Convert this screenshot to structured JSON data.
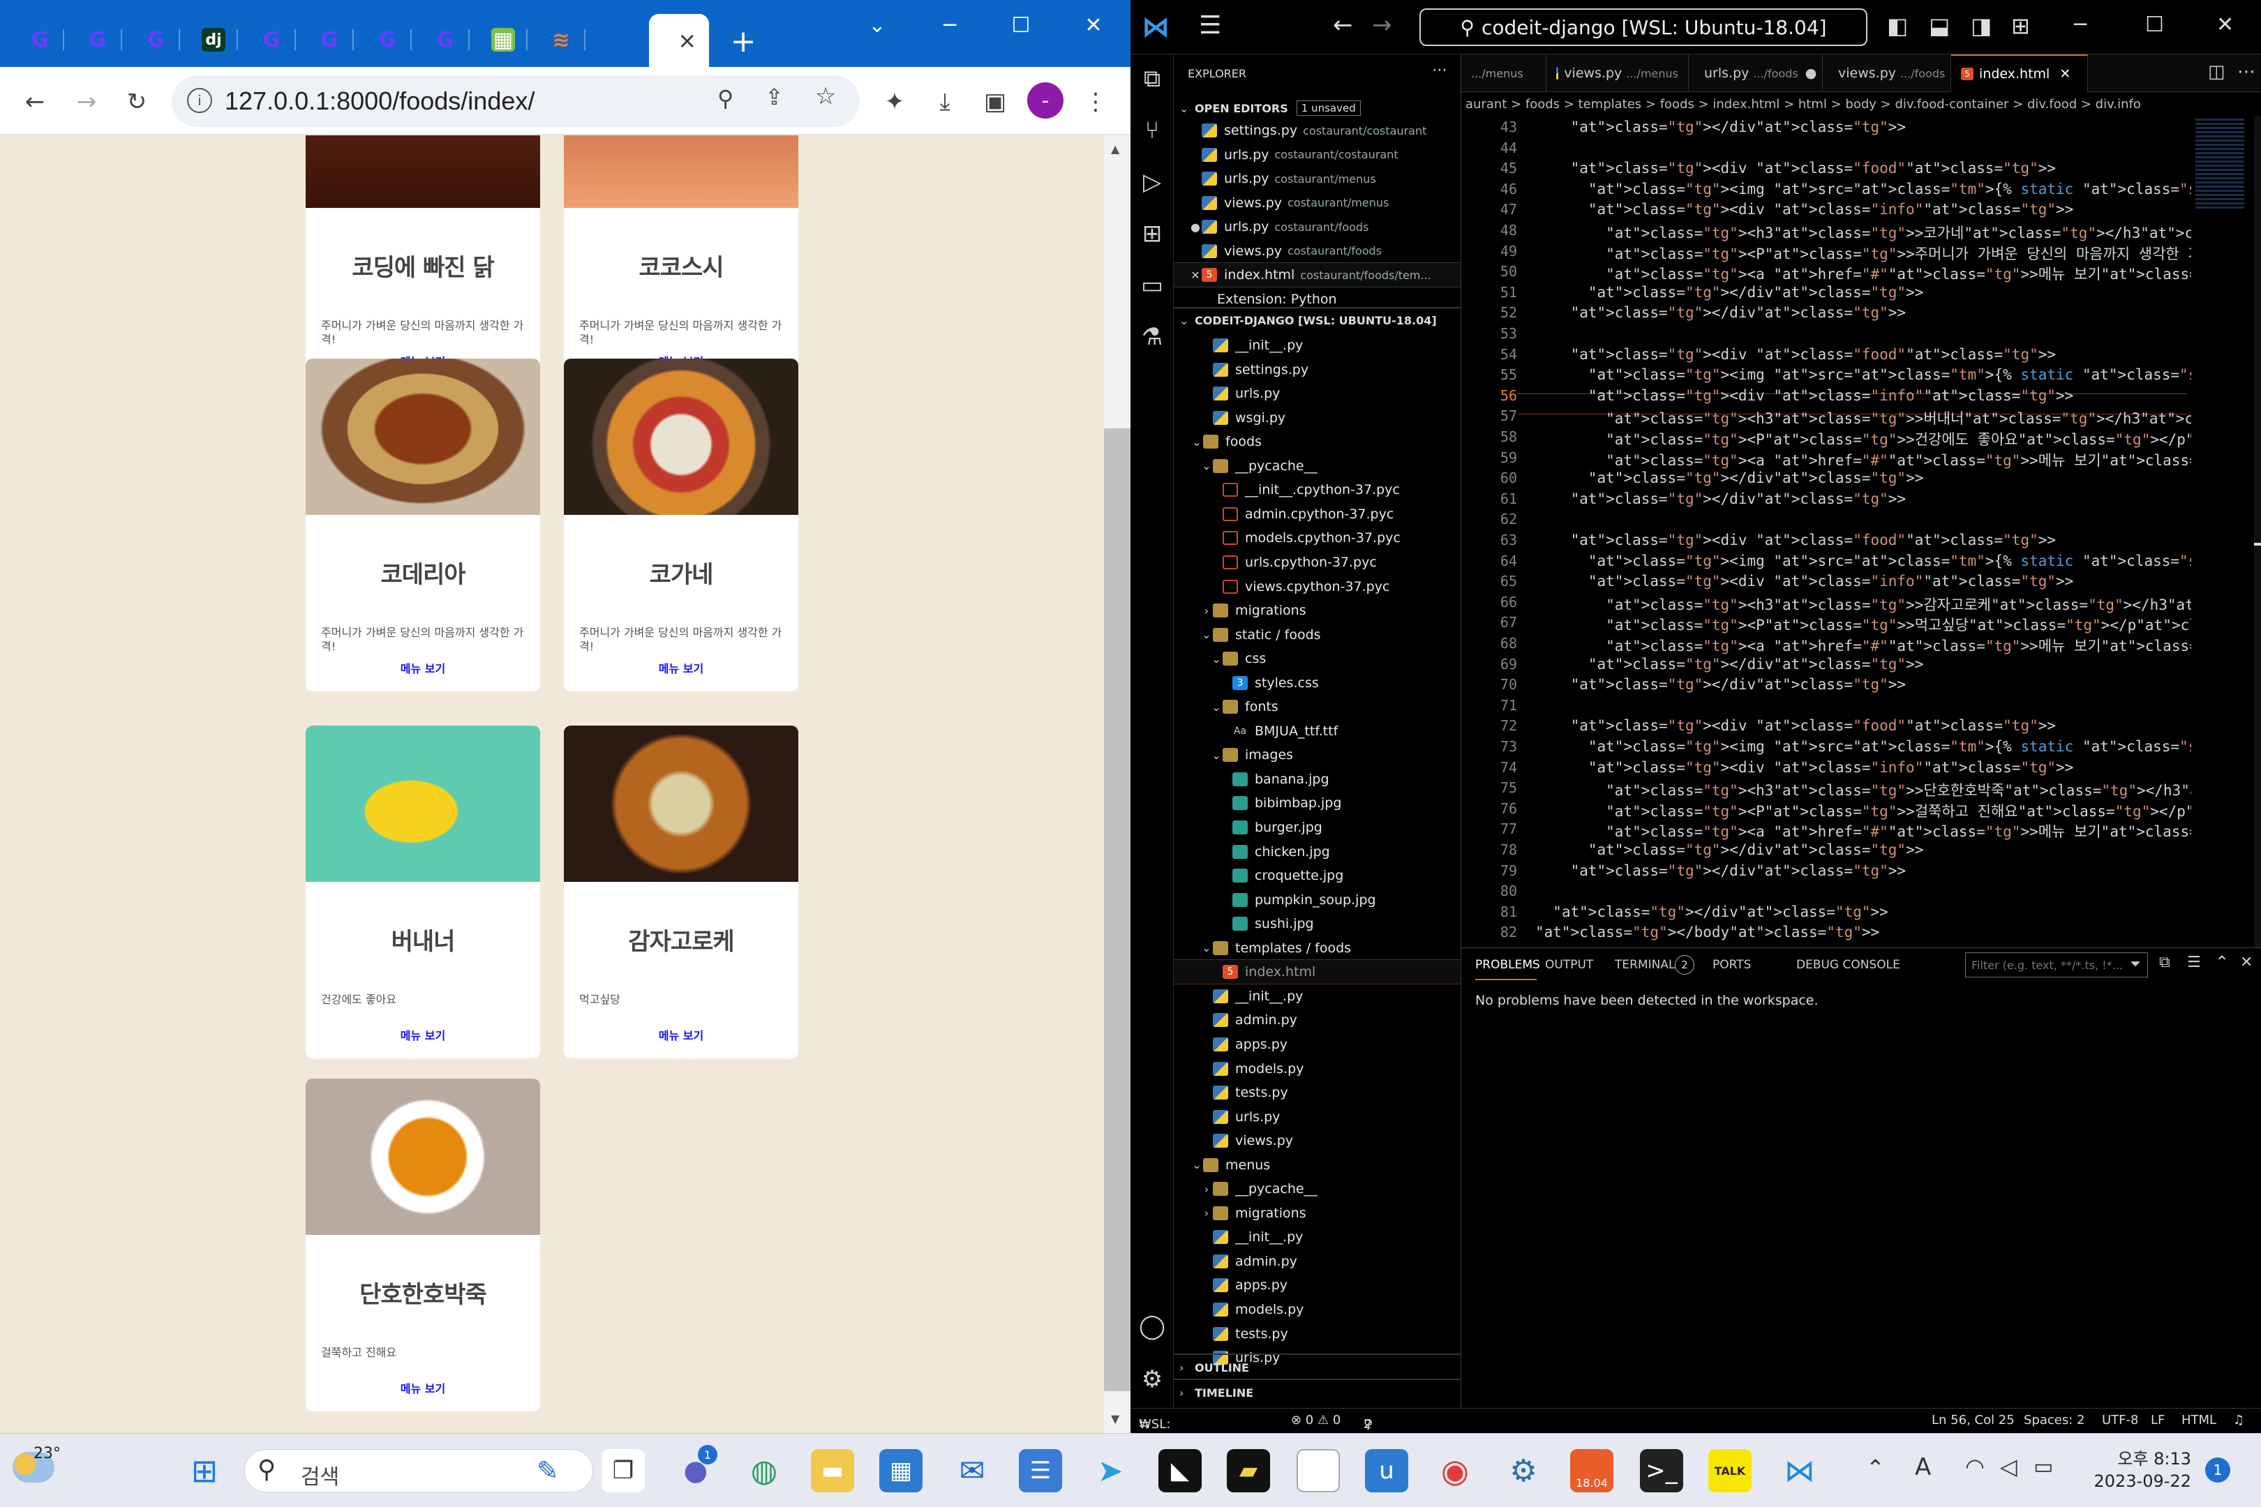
{
  "browser": {
    "url": "127.0.0.1:8000/foods/index/",
    "tab_count_icons": [
      "codeit",
      "codeit",
      "codeit",
      "django",
      "codeit",
      "codeit",
      "codeit",
      "codeit",
      "kakao",
      "stack"
    ],
    "new_tab_label": "+",
    "close_tab_label": "×"
  },
  "foods": [
    {
      "name": "코딩에 빠진 닭",
      "desc": "주머니가 가벼운 당신의 마음까지 생각한 가격!",
      "link": "메뉴 보기"
    },
    {
      "name": "코코스시",
      "desc": "주머니가 가벼운 당신의 마음까지 생각한 가격!",
      "link": "메뉴 보기"
    },
    {
      "name": "코데리아",
      "desc": "주머니가 가벼운 당신의 마음까지 생각한 가격!",
      "link": "메뉴 보기"
    },
    {
      "name": "코가네",
      "desc": "주머니가 가벼운 당신의 마음까지 생각한 가격!",
      "link": "메뉴 보기"
    },
    {
      "name": "버내너",
      "desc": "건강에도 좋아요",
      "link": "메뉴 보기"
    },
    {
      "name": "감자고로케",
      "desc": "먹고싶당",
      "link": "메뉴 보기"
    },
    {
      "name": "단호한호박죽",
      "desc": "걸쭉하고 진해요",
      "link": "메뉴 보기"
    }
  ],
  "vscode": {
    "command_center": "codeit-django [WSL: Ubuntu-18.04]",
    "explorer_title": "EXPLORER",
    "open_editors_label": "OPEN EDITORS",
    "unsaved_badge": "1 unsaved",
    "open_editors": [
      {
        "name": "settings.py",
        "path": "costaurant/costaurant"
      },
      {
        "name": "urls.py",
        "path": "costaurant/costaurant"
      },
      {
        "name": "urls.py",
        "path": "costaurant/menus"
      },
      {
        "name": "views.py",
        "path": "costaurant/menus"
      },
      {
        "name": "urls.py",
        "path": "costaurant/foods"
      },
      {
        "name": "views.py",
        "path": "costaurant/foods"
      },
      {
        "name": "index.html",
        "path": "costaurant/foods/tem..."
      },
      {
        "name": "Extension: Python",
        "path": ""
      }
    ],
    "workspace_label": "CODEIT-DJANGO [WSL: UBUNTU-18.04]",
    "tree": [
      {
        "name": "__init__.py",
        "kind": "py",
        "depth": 2
      },
      {
        "name": "settings.py",
        "kind": "py",
        "depth": 2
      },
      {
        "name": "urls.py",
        "kind": "py",
        "depth": 2
      },
      {
        "name": "wsgi.py",
        "kind": "py",
        "depth": 2
      },
      {
        "name": "foods",
        "kind": "folder-open",
        "depth": 1
      },
      {
        "name": "__pycache__",
        "kind": "folder-open",
        "depth": 2
      },
      {
        "name": "__init__.cpython-37.pyc",
        "kind": "pyc",
        "depth": 3
      },
      {
        "name": "admin.cpython-37.pyc",
        "kind": "pyc",
        "depth": 3
      },
      {
        "name": "models.cpython-37.pyc",
        "kind": "pyc",
        "depth": 3
      },
      {
        "name": "urls.cpython-37.pyc",
        "kind": "pyc",
        "depth": 3
      },
      {
        "name": "views.cpython-37.pyc",
        "kind": "pyc",
        "depth": 3
      },
      {
        "name": "migrations",
        "kind": "folder",
        "depth": 2
      },
      {
        "name": "static / foods",
        "kind": "folder-open",
        "depth": 2
      },
      {
        "name": "css",
        "kind": "folder-open",
        "depth": 3
      },
      {
        "name": "styles.css",
        "kind": "css",
        "depth": 4
      },
      {
        "name": "fonts",
        "kind": "folder-open",
        "depth": 3
      },
      {
        "name": "BMJUA_ttf.ttf",
        "kind": "font",
        "depth": 4
      },
      {
        "name": "images",
        "kind": "folder-open",
        "depth": 3
      },
      {
        "name": "banana.jpg",
        "kind": "img",
        "depth": 4
      },
      {
        "name": "bibimbap.jpg",
        "kind": "img",
        "depth": 4
      },
      {
        "name": "burger.jpg",
        "kind": "img",
        "depth": 4
      },
      {
        "name": "chicken.jpg",
        "kind": "img",
        "depth": 4
      },
      {
        "name": "croquette.jpg",
        "kind": "img",
        "depth": 4
      },
      {
        "name": "pumpkin_soup.jpg",
        "kind": "img",
        "depth": 4
      },
      {
        "name": "sushi.jpg",
        "kind": "img",
        "depth": 4
      },
      {
        "name": "templates / foods",
        "kind": "folder-open",
        "depth": 2
      },
      {
        "name": "index.html",
        "kind": "htm",
        "depth": 3
      },
      {
        "name": "__init__.py",
        "kind": "py",
        "depth": 2
      },
      {
        "name": "admin.py",
        "kind": "py",
        "depth": 2
      },
      {
        "name": "apps.py",
        "kind": "py",
        "depth": 2
      },
      {
        "name": "models.py",
        "kind": "py",
        "depth": 2
      },
      {
        "name": "tests.py",
        "kind": "py",
        "depth": 2
      },
      {
        "name": "urls.py",
        "kind": "py",
        "depth": 2
      },
      {
        "name": "views.py",
        "kind": "py",
        "depth": 2
      },
      {
        "name": "menus",
        "kind": "folder-open",
        "depth": 1
      },
      {
        "name": "__pycache__",
        "kind": "folder",
        "depth": 2
      },
      {
        "name": "migrations",
        "kind": "folder",
        "depth": 2
      },
      {
        "name": "__init__.py",
        "kind": "py",
        "depth": 2
      },
      {
        "name": "admin.py",
        "kind": "py",
        "depth": 2
      },
      {
        "name": "apps.py",
        "kind": "py",
        "depth": 2
      },
      {
        "name": "models.py",
        "kind": "py",
        "depth": 2
      },
      {
        "name": "tests.py",
        "kind": "py",
        "depth": 2
      },
      {
        "name": "urls.py",
        "kind": "py",
        "depth": 2
      }
    ],
    "outline_label": "OUTLINE",
    "timeline_label": "TIMELINE",
    "editor_tabs": [
      {
        "name": ".../menus",
        "dir": ""
      },
      {
        "name": "views.py",
        "dir": ".../menus"
      },
      {
        "name": "urls.py",
        "dir": ".../foods"
      },
      {
        "name": "views.py",
        "dir": ".../foods"
      },
      {
        "name": "index.html",
        "dir": ""
      }
    ],
    "breadcrumbs": "aurant > foods > templates > foods > index.html > html > body > div.food-container > div.food > div.info",
    "code_lines": [
      {
        "n": "43",
        "t": "    </div>"
      },
      {
        "n": "44",
        "t": ""
      },
      {
        "n": "45",
        "t": "    <div class=\"food\">"
      },
      {
        "n": "46",
        "t": "      <img src={% static 'foods/images/bibimbap.jpg' %} width=\"300px\" height="
      },
      {
        "n": "47",
        "t": "      <div class=\"info\">"
      },
      {
        "n": "48",
        "t": "        <h3>코가네</h3>"
      },
      {
        "n": "49",
        "t": "        <P>주머니가 가벼운 당신의 마음까지 생각한 가격!</p>"
      },
      {
        "n": "50",
        "t": "        <a href=\"#\">메뉴 보기</a>"
      },
      {
        "n": "51",
        "t": "      </div>"
      },
      {
        "n": "52",
        "t": "    </div>"
      },
      {
        "n": "53",
        "t": ""
      },
      {
        "n": "54",
        "t": "    <div class=\"food\">"
      },
      {
        "n": "55",
        "t": "      <img src={% static 'foods/images/banana.jpg' %} width=\"300px\" height=\"2"
      },
      {
        "n": "56",
        "t": "      <div class=\"info\">"
      },
      {
        "n": "57",
        "t": "        <h3>버내너</h3>"
      },
      {
        "n": "58",
        "t": "        <P>건강에도 좋아요</p>"
      },
      {
        "n": "59",
        "t": "        <a href=\"#\">메뉴 보기</a>"
      },
      {
        "n": "60",
        "t": "      </div>"
      },
      {
        "n": "61",
        "t": "    </div>"
      },
      {
        "n": "62",
        "t": ""
      },
      {
        "n": "63",
        "t": "    <div class=\"food\">"
      },
      {
        "n": "64",
        "t": "      <img src={% static 'foods/images/croquette.jpg' %} width=\"300px\" height"
      },
      {
        "n": "65",
        "t": "      <div class=\"info\">"
      },
      {
        "n": "66",
        "t": "        <h3>감자고로케</h3>"
      },
      {
        "n": "67",
        "t": "        <P>먹고싶당</p>"
      },
      {
        "n": "68",
        "t": "        <a href=\"#\">메뉴 보기</a>"
      },
      {
        "n": "69",
        "t": "      </div>"
      },
      {
        "n": "70",
        "t": "    </div>"
      },
      {
        "n": "71",
        "t": ""
      },
      {
        "n": "72",
        "t": "    <div class=\"food\">"
      },
      {
        "n": "73",
        "t": "      <img src={% static 'foods/images/pumpkin_soup.jpg' %} width=\"300px\" hei"
      },
      {
        "n": "74",
        "t": "      <div class=\"info\">"
      },
      {
        "n": "75",
        "t": "        <h3>단호한호박죽</h3>"
      },
      {
        "n": "76",
        "t": "        <P>걸쭉하고 진해요</p>"
      },
      {
        "n": "77",
        "t": "        <a href=\"#\">메뉴 보기</a>"
      },
      {
        "n": "78",
        "t": "      </div>"
      },
      {
        "n": "79",
        "t": "    </div>"
      },
      {
        "n": "80",
        "t": ""
      },
      {
        "n": "81",
        "t": "  </div>"
      },
      {
        "n": "82",
        "t": "</body>"
      }
    ],
    "panel_tabs": [
      "PROBLEMS",
      "OUTPUT",
      "TERMINAL",
      "PORTS",
      "DEBUG CONSOLE"
    ],
    "ports_badge": "2",
    "filter_placeholder": "Filter (e.g. text, **/*.ts, !*...",
    "panel_message": "No problems have been detected in the workspace.",
    "status": {
      "remote": "WSL: Ubuntu-18.04",
      "problems": "⊗ 0 ⚠ 0",
      "ports": "2",
      "position": "Ln 56, Col 25",
      "spaces": "Spaces: 2",
      "encoding": "UTF-8",
      "eol": "LF",
      "language": "HTML"
    }
  },
  "taskbar": {
    "weather": "23°",
    "search_placeholder": "검색",
    "chat_badge": "1",
    "time": "오후 8:13",
    "date": "2023-09-22",
    "notification_badge": "1",
    "app_badge_date": "18.04",
    "kakao_label": "TALK"
  }
}
